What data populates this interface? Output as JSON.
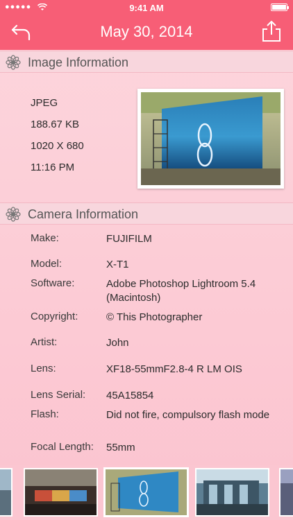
{
  "status_bar": {
    "signal": "●●●●● ",
    "time": "9:41 AM"
  },
  "nav": {
    "title": "May 30, 2014"
  },
  "icons": {
    "back": "back-arrow-icon",
    "share": "share-upload-icon",
    "section": "flower-icon",
    "wifi": "wifi-icon",
    "battery": "battery-icon"
  },
  "colors": {
    "accent": "#f75e76",
    "background": "#fbc3cf",
    "section_header": "#f8d6dd"
  },
  "image_info": {
    "header": "Image Information",
    "format": "JPEG",
    "size": "188.67 KB",
    "dimensions": "1020 X 680",
    "time": "11:16 PM"
  },
  "camera_info": {
    "header": "Camera Information",
    "rows": [
      {
        "label": "Make:",
        "value": "FUJIFILM"
      },
      {
        "label": "Model:",
        "value": "X-T1"
      },
      {
        "label": "Software:",
        "value": "Adobe Photoshop Lightroom 5.4 (Macintosh)"
      },
      {
        "label": "Copyright:",
        "value": "© This Photographer"
      },
      {
        "label": "Artist:",
        "value": "John"
      },
      {
        "label": "Lens:",
        "value": "XF18-55mmF2.8-4 R LM OIS"
      },
      {
        "label": "Lens Serial:",
        "value": "45A15854"
      },
      {
        "label": "Flash:",
        "value": "Did not fire, compulsory flash mode"
      },
      {
        "label": "Focal Length:",
        "value": "55mm"
      }
    ]
  },
  "filmstrip": {
    "selected_index": 2
  }
}
